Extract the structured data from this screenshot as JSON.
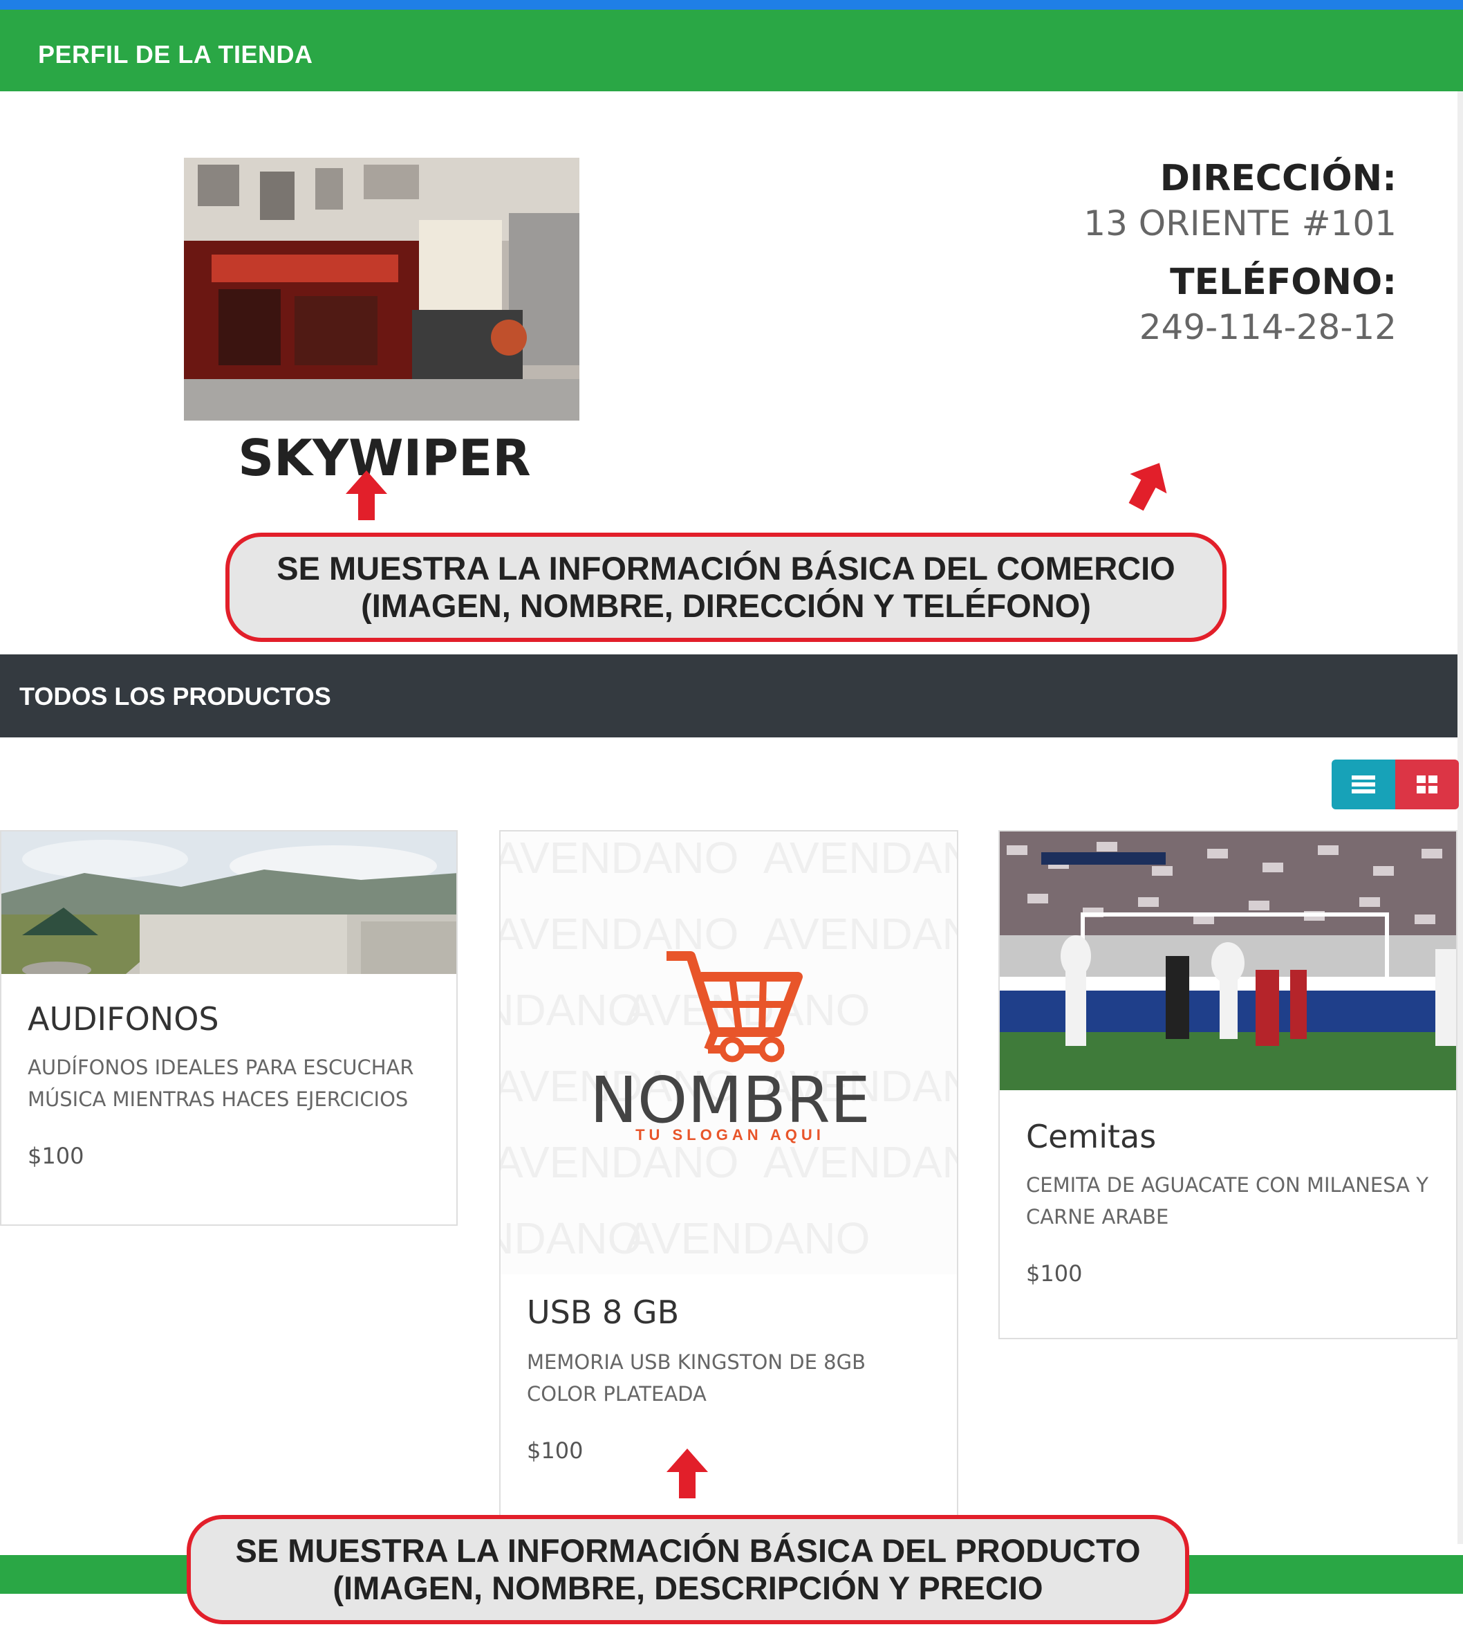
{
  "store_section": {
    "title": "PERFIL DE LA TIENDA"
  },
  "store": {
    "name": "SKYWIPER",
    "address_label": "DIRECCIÓN:",
    "address": "13 ORIENTE #101",
    "phone_label": "TELÉFONO:",
    "phone": "249-114-28-12"
  },
  "callouts": {
    "store_line1": "SE MUESTRA LA INFORMACIÓN BÁSICA DEL COMERCIO",
    "store_line2": "(IMAGEN, NOMBRE, DIRECCIÓN Y TELÉFONO)",
    "product_line1": "SE MUESTRA LA INFORMACIÓN BÁSICA DEL PRODUCTO",
    "product_line2": "(IMAGEN, NOMBRE, DESCRIPCIÓN Y PRECIO"
  },
  "products_section": {
    "title": "TODOS LOS PRODUCTOS"
  },
  "view_toggle": {
    "list_icon": "list-icon",
    "grid_icon": "grid-icon"
  },
  "products": [
    {
      "name": "AUDIFONOS",
      "description": "AUDÍFONOS IDEALES PARA ESCUCHAR MÚSICA MIENTRAS HACES EJERCICIOS",
      "price": "$100"
    },
    {
      "name": "USB 8 GB",
      "description": "MEMORIA USB KINGSTON DE 8GB COLOR PLATEADA",
      "price": "$100"
    },
    {
      "name": "Cemitas",
      "description": "CEMITA DE AGUACATE CON MILANESA Y CARNE ARABE",
      "price": "$100"
    }
  ],
  "logo_placeholder": {
    "word": "NOMBRE",
    "slogan": "TU SLOGAN AQUI",
    "watermark": "AVENDANO"
  },
  "colors": {
    "green": "#2aa745",
    "dark": "#343a40",
    "teal": "#17a2b8",
    "red": "#dc3545",
    "callout_border": "#e21f2a"
  }
}
